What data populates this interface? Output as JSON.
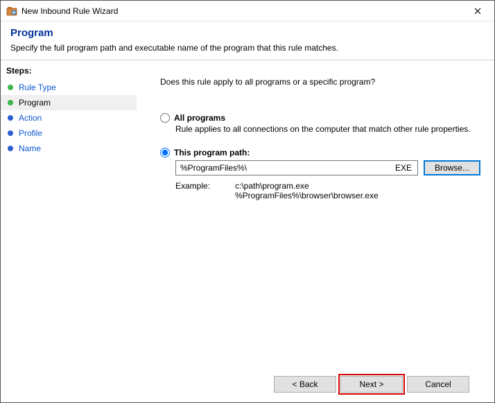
{
  "window": {
    "title": "New Inbound Rule Wizard"
  },
  "header": {
    "page_title": "Program",
    "page_desc": "Specify the full program path and executable name of the program that this rule matches."
  },
  "sidebar": {
    "heading": "Steps:",
    "items": [
      {
        "label": "Rule Type"
      },
      {
        "label": "Program"
      },
      {
        "label": "Action"
      },
      {
        "label": "Profile"
      },
      {
        "label": "Name"
      }
    ]
  },
  "content": {
    "question": "Does this rule apply to all programs or a specific program?",
    "option_all": {
      "label": "All programs",
      "desc": "Rule applies to all connections on the computer that match other rule properties."
    },
    "option_path": {
      "label": "This program path:",
      "value": "%ProgramFiles%\\",
      "ext": "EXE",
      "browse": "Browse...",
      "example_label": "Example:",
      "example_line1": "c:\\path\\program.exe",
      "example_line2": "%ProgramFiles%\\browser\\browser.exe"
    }
  },
  "footer": {
    "back": "< Back",
    "next": "Next >",
    "cancel": "Cancel"
  }
}
